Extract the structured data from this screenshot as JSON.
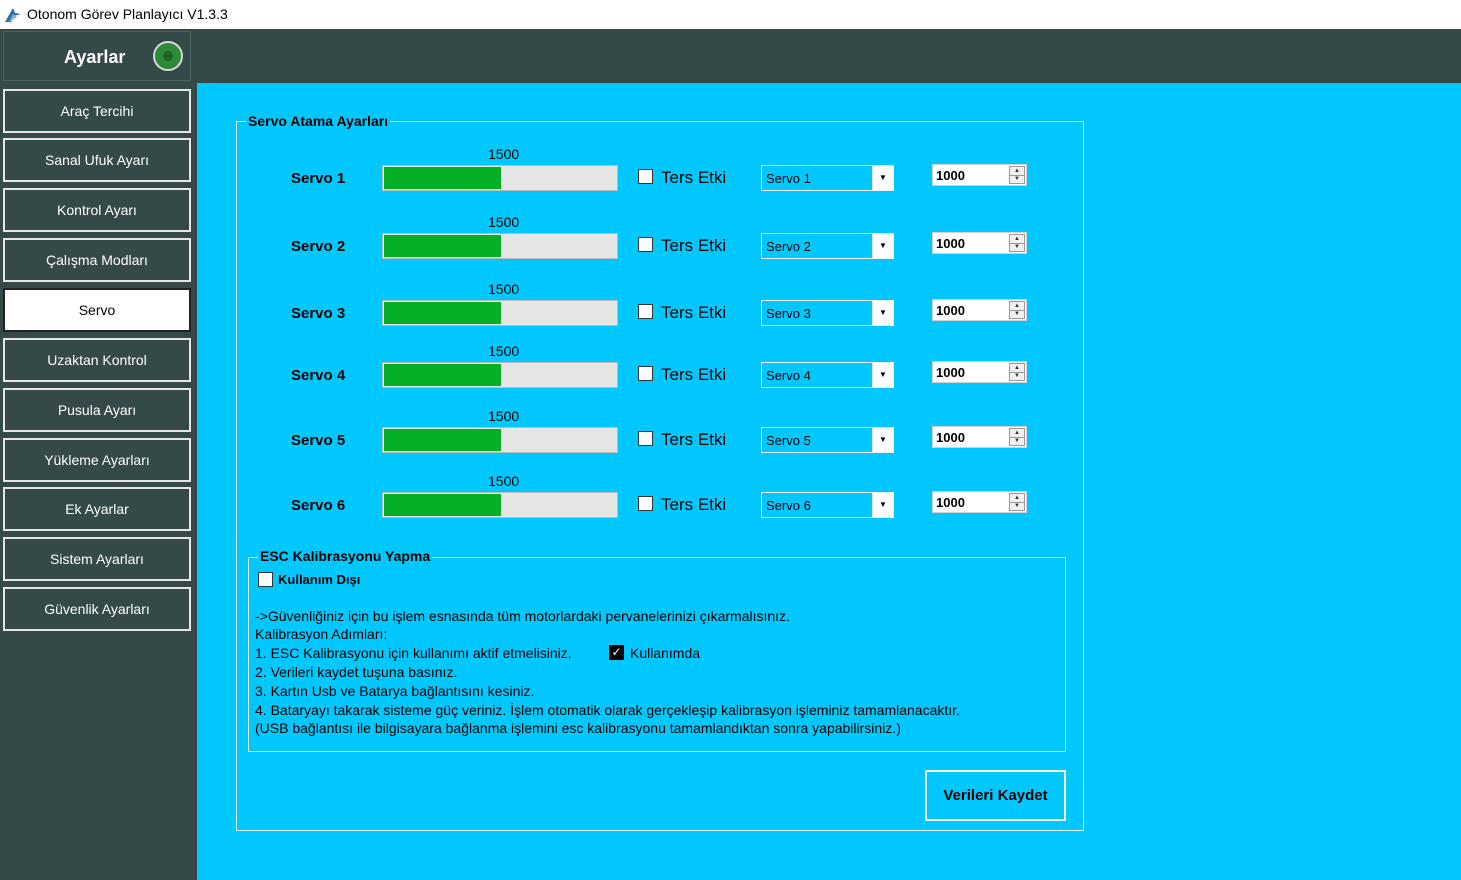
{
  "window": {
    "title": "Otonom Görev Planlayıcı V1.3.3"
  },
  "sidebar": {
    "header": "Ayarlar",
    "items": [
      {
        "label": "Araç Tercihi",
        "active": false
      },
      {
        "label": "Sanal Ufuk Ayarı",
        "active": false
      },
      {
        "label": "Kontrol Ayarı",
        "active": false
      },
      {
        "label": "Çalışma Modları",
        "active": false
      },
      {
        "label": "Servo",
        "active": true
      },
      {
        "label": "Uzaktan Kontrol",
        "active": false
      },
      {
        "label": "Pusula Ayarı",
        "active": false
      },
      {
        "label": "Yükleme Ayarları",
        "active": false
      },
      {
        "label": "Ek Ayarlar",
        "active": false
      },
      {
        "label": "Sistem Ayarları",
        "active": false
      },
      {
        "label": "Güvenlik Ayarları",
        "active": false
      }
    ]
  },
  "servo_group": {
    "title": "Servo Atama Ayarları",
    "reverse_label": "Ters Etki",
    "servos": [
      {
        "label": "Servo 1",
        "value": "1500",
        "level": 0.5,
        "reverse": false,
        "assignment": "Servo 1",
        "number": "1000"
      },
      {
        "label": "Servo 2",
        "value": "1500",
        "level": 0.5,
        "reverse": false,
        "assignment": "Servo 2",
        "number": "1000"
      },
      {
        "label": "Servo 3",
        "value": "1500",
        "level": 0.5,
        "reverse": false,
        "assignment": "Servo 3",
        "number": "1000"
      },
      {
        "label": "Servo 4",
        "value": "1500",
        "level": 0.5,
        "reverse": false,
        "assignment": "Servo 4",
        "number": "1000"
      },
      {
        "label": "Servo 5",
        "value": "1500",
        "level": 0.5,
        "reverse": false,
        "assignment": "Servo 5",
        "number": "1000"
      },
      {
        "label": "Servo 6",
        "value": "1500",
        "level": 0.5,
        "reverse": false,
        "assignment": "Servo 6",
        "number": "1000"
      }
    ]
  },
  "esc_group": {
    "title": "ESC Kalibrasyonu Yapma",
    "disabled_label": "Kullanım Dışı",
    "line1": "->Güvenliğiniz için bu işlem esnasında tüm motorlardaki pervanelerinizi çıkarmalısınız.",
    "line2": "Kalibrasyon Adımları:",
    "line3": "1. ESC Kalibrasyonu için kullanımı aktif etmelisiniz.",
    "in_use_label": "Kullanımda",
    "line4": "2. Verileri kaydet tuşuna basınız.",
    "line5": "3. Kartın Usb ve Batarya bağlantısını kesiniz.",
    "line6": "4. Bataryayı takarak sisteme güç veriniz. İşlem otomatik olarak gerçekleşip kalibrasyon işleminiz tamamlanacaktır.",
    "line7": "(USB bağlantısı ile bilgisayara bağlanma işlemini esc kalibrasyonu tamamlandıktan sonra yapabilirsiniz.)"
  },
  "save_button": "Verileri Kaydet",
  "colors": {
    "accent": "#00c8ff",
    "sidebar": "#354a48",
    "bar_fill": "#06b025"
  }
}
